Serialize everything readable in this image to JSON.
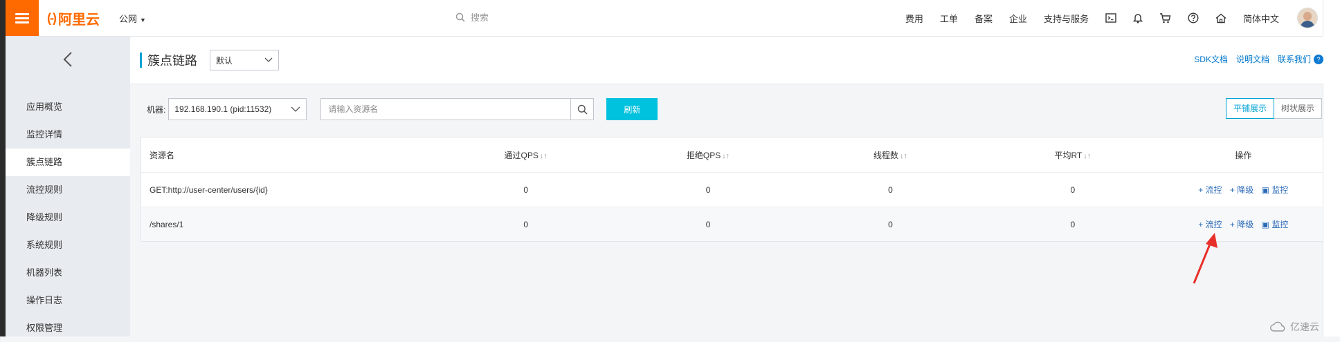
{
  "topbar": {
    "logo_mark": "(-)",
    "logo_text": "阿里云",
    "region": "公网",
    "search_placeholder": "搜索",
    "links": [
      "费用",
      "工单",
      "备案",
      "企业",
      "支持与服务"
    ],
    "language": "简体中文"
  },
  "sidebar": {
    "items": [
      {
        "label": "应用概览"
      },
      {
        "label": "监控详情"
      },
      {
        "label": "簇点链路",
        "active": true
      },
      {
        "label": "流控规则"
      },
      {
        "label": "降级规则"
      },
      {
        "label": "系统规则"
      },
      {
        "label": "机器列表"
      },
      {
        "label": "操作日志"
      },
      {
        "label": "权限管理"
      }
    ]
  },
  "page": {
    "title": "簇点链路",
    "env_select": "默认",
    "links": {
      "sdk": "SDK文档",
      "manual": "说明文档",
      "contact": "联系我们"
    }
  },
  "toolbar": {
    "machine_label": "机器:",
    "machine_value": "192.168.190.1 (pid:11532)",
    "resource_placeholder": "请输入资源名",
    "refresh": "刷新",
    "view_flat": "平铺展示",
    "view_tree": "树状展示"
  },
  "table": {
    "headers": {
      "name": "资源名",
      "pass_qps": "通过QPS",
      "block_qps": "拒绝QPS",
      "threads": "线程数",
      "avg_rt": "平均RT",
      "ops": "操作"
    },
    "rows": [
      {
        "name": "GET:http://user-center/users/{id}",
        "pass_qps": "0",
        "block_qps": "0",
        "threads": "0",
        "avg_rt": "0"
      },
      {
        "name": "/shares/1",
        "pass_qps": "0",
        "block_qps": "0",
        "threads": "0",
        "avg_rt": "0"
      }
    ],
    "actions": {
      "flow": "流控",
      "degrade": "降级",
      "monitor": "监控"
    }
  },
  "watermark": "亿速云",
  "colors": {
    "brand": "#ff6a00",
    "primary": "#00c1de",
    "link": "#2b6ab7",
    "arrow": "#e8302a"
  }
}
